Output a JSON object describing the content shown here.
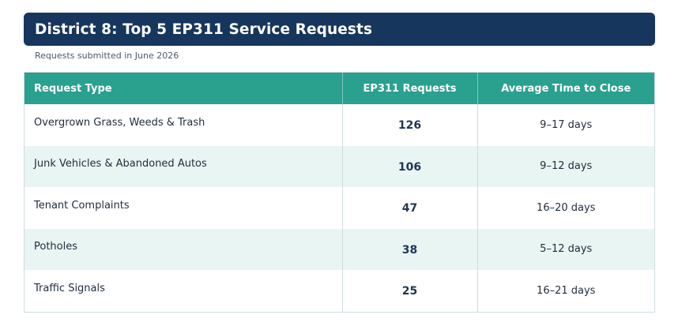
{
  "header": {
    "title": "District 8: Top 5 EP311 Service Requests",
    "subtitle": "Requests submitted in June 2026"
  },
  "table": {
    "columns": [
      "Request Type",
      "EP311 Requests",
      "Average Time to Close"
    ],
    "rows": [
      {
        "type": "Overgrown Grass, Weeds & Trash",
        "count": "126",
        "time": "9–17 days"
      },
      {
        "type": "Junk Vehicles & Abandoned Autos",
        "count": "106",
        "time": "9–12 days"
      },
      {
        "type": "Tenant Complaints",
        "count": "47",
        "time": "16–20 days"
      },
      {
        "type": "Potholes",
        "count": "38",
        "time": "5–12 days"
      },
      {
        "type": "Traffic Signals",
        "count": "25",
        "time": "16–21 days"
      }
    ]
  },
  "colors": {
    "banner": "#17365d",
    "header_row": "#2aa08f",
    "alt_row": "#e9f5f3"
  }
}
